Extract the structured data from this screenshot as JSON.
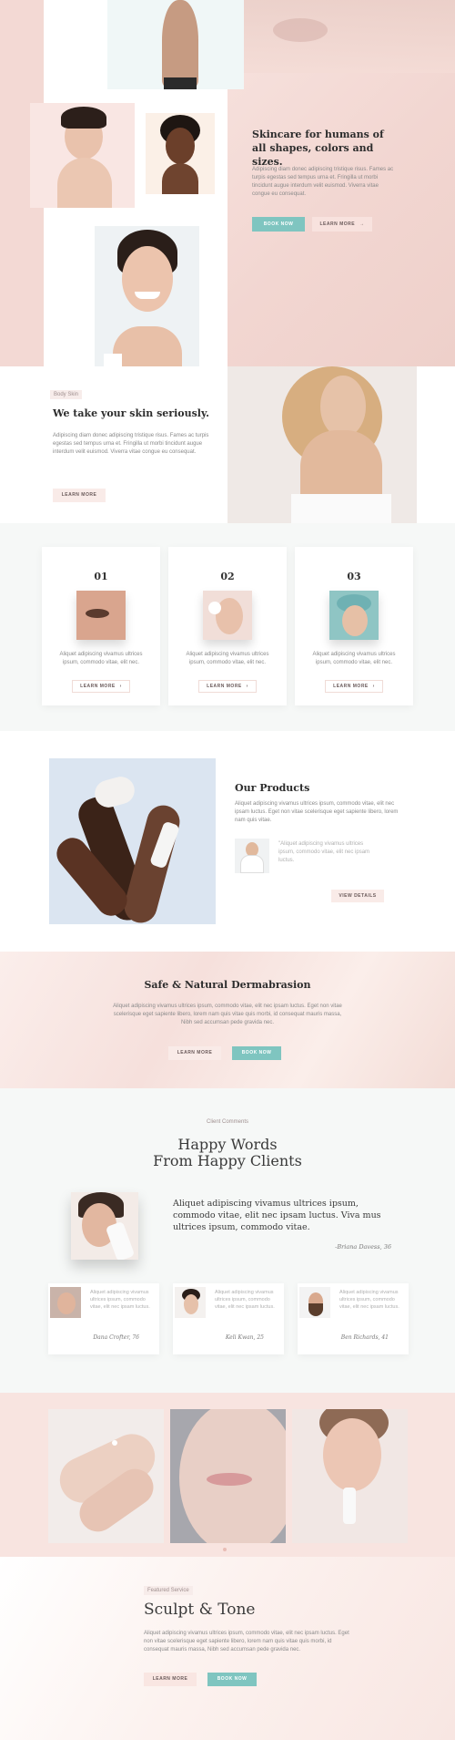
{
  "hero": {
    "title": "Skincare for humans of all shapes, colors and sizes.",
    "text": "Adipiscing diam donec adipiscing tristique risus. Fames ac turpis egestas sed tempus urna et. Fringilla ut morbi tincidunt augue interdum velit euismod. Viverra vitae congue eu consequat.",
    "book_label": "BOOK NOW",
    "learn_label": "LEARN MORE"
  },
  "body_skin": {
    "eyebrow": "Body Skin",
    "title": "We take your skin seriously.",
    "text": "Adipiscing diam donec adipiscing tristique risus. Fames ac turpis egestas sed tempus urna et. Fringilla ut morbi tincidunt augue interdum velit euismod. Viverra vitae congue eu consequat.",
    "learn_label": "LEARN MORE"
  },
  "steps": [
    {
      "number": "01",
      "text": "Aliquet adipiscing vivamus ultrices ipsum, commodo vitae, elit nec.",
      "button": "LEARN MORE"
    },
    {
      "number": "02",
      "text": "Aliquet adipiscing vivamus ultrices ipsum, commodo vitae, elit nec.",
      "button": "LEARN MORE"
    },
    {
      "number": "03",
      "text": "Aliquet adipiscing vivamus ultrices ipsum, commodo vitae, elit nec.",
      "button": "LEARN MORE"
    }
  ],
  "products": {
    "title": "Our Products",
    "text": "Aliquet adipiscing vivamus ultrices ipsum, commodo vitae, elit nec ipsam luctus. Eget non vitae scelerisque eget sapiente libero, lorem nam quis vitae.",
    "quote": "\"Aliquet adipiscing vivamus ultrices ipsum, commodo vitae, elit nec ipsam luctus.",
    "button": "VIEW DETAILS"
  },
  "dermabrasion": {
    "title": "Safe & Natural Dermabrasion",
    "text": "Aliquet adipiscing vivamus ultrices ipsum, commodo vitae, elit nec ipsam luctus. Eget non vitae scelerisque eget sapiente libero, lorem nam quis vitae quis morbi, id consequat mauris massa, Nibh sed accumsan pede gravida nec.",
    "learn_label": "LEARN MORE",
    "book_label": "BOOK NOW"
  },
  "testimonials": {
    "eyebrow": "Client Comments",
    "title_line1": "Happy Words",
    "title_line2": "From Happy Clients",
    "featured_quote": "Aliquet adipiscing vivamus ultrices ipsum, commodo vitae, elit nec ipsam luctus. Viva mus ultrices ipsum, commodo vitae.",
    "featured_author": "-Briana Davess, 36",
    "cards": [
      {
        "text": "Aliquet adipiscing vivamus ultrices ipsum, commodo vitae, elit nec ipsam luctus.",
        "author": "Dana Crofter, 76"
      },
      {
        "text": "Aliquet adipiscing vivamus ultrices ipsum, commodo vitae, elit nec ipsam luctus.",
        "author": "Keli Kwan, 25"
      },
      {
        "text": "Aliquet adipiscing vivamus ultrices ipsum, commodo vitae, elit nec ipsam luctus.",
        "author": "Ben Richards, 41"
      }
    ]
  },
  "featured_service": {
    "eyebrow": "Featured Service",
    "title": "Sculpt & Tone",
    "text": "Aliquet adipiscing vivamus ultrices ipsum, commodo vitae, elit nec ipsam luctus. Eget non vitae scelerisque eget sapiente libero, lorem nam quis vitae quis morbi, id consequat mauris massa, Nibh sed accumsan pede gravida nec.",
    "learn_label": "LEARN MORE",
    "book_label": "BOOK NOW"
  },
  "colors": {
    "accent_teal": "#7fc5c0",
    "blush": "#f6e0dc",
    "light_gray_bg": "#f6f8f7"
  }
}
